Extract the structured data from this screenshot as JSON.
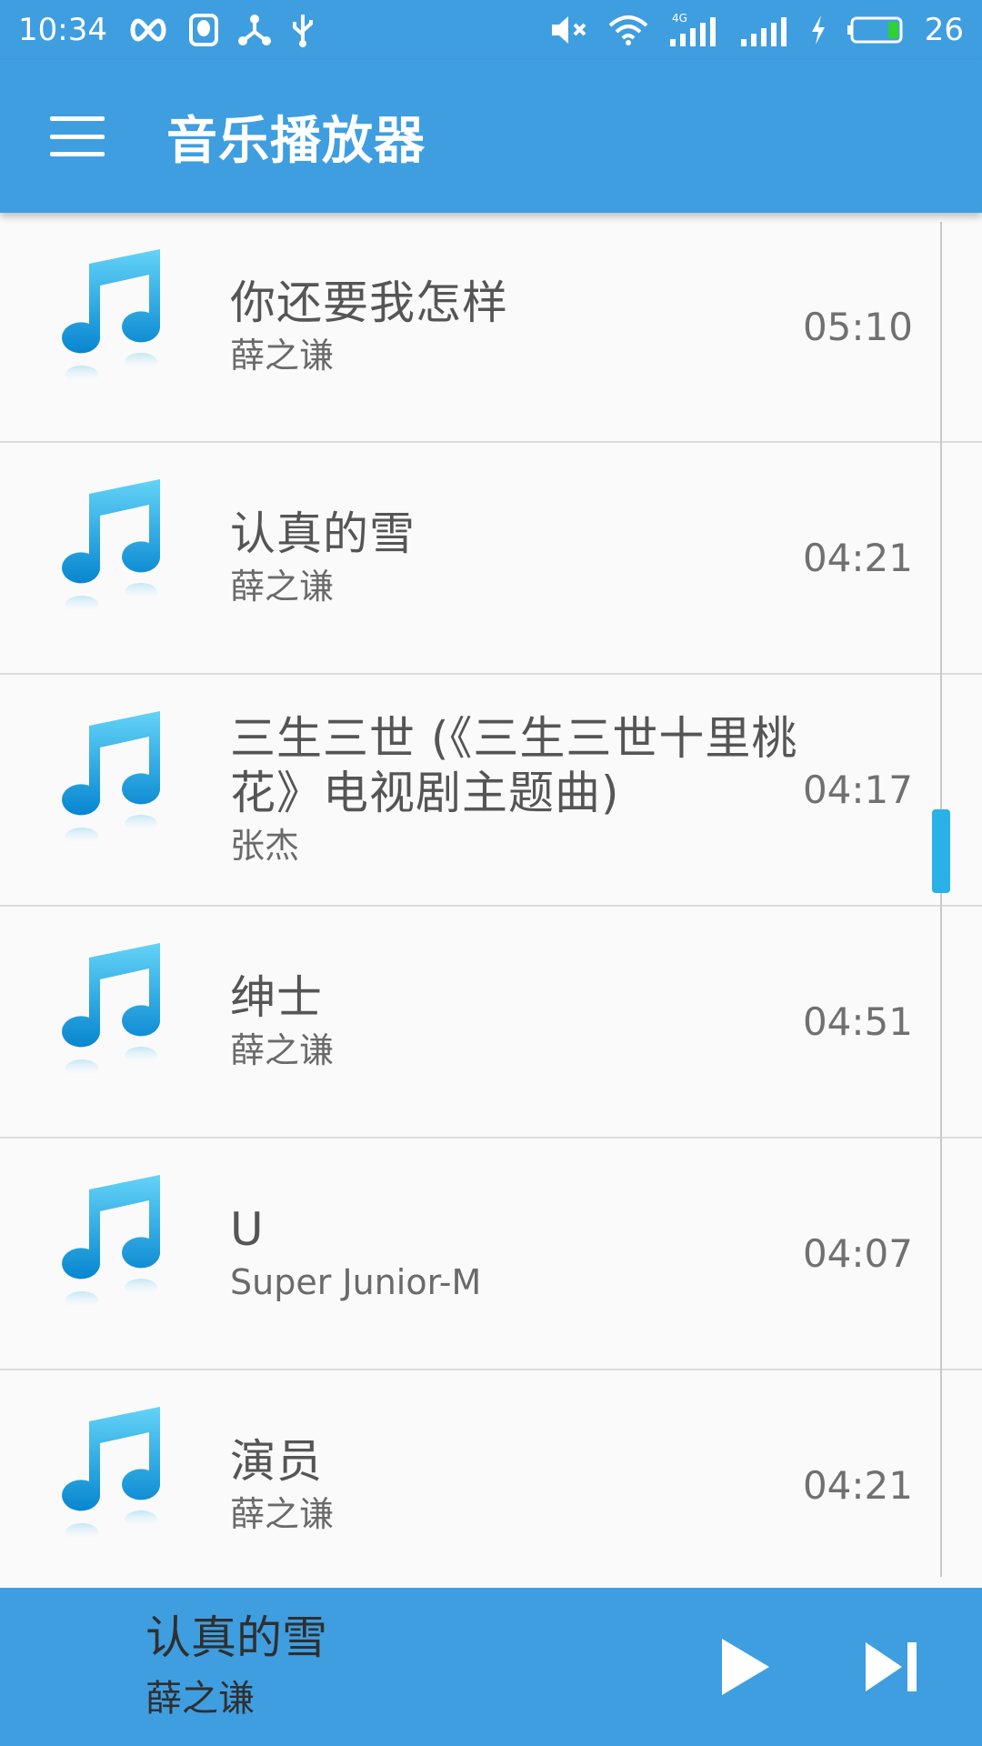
{
  "status_bar": {
    "time": "10:34",
    "network": "4G",
    "battery": "26",
    "left_icons": [
      "infinity-icon",
      "qq-icon",
      "share-icon",
      "usb-icon"
    ],
    "right_icons": [
      "mute-icon",
      "wifi-icon",
      "signal-4g-icon",
      "signal-icon",
      "charging-icon",
      "battery-icon"
    ]
  },
  "toolbar": {
    "title": "音乐播放器",
    "menu_icon": "menu-icon"
  },
  "songs": [
    {
      "title": "你还要我怎样",
      "artist": "薛之谦",
      "duration": "05:10"
    },
    {
      "title": "认真的雪",
      "artist": "薛之谦",
      "duration": "04:21"
    },
    {
      "title": "三生三世 (《三生三世十里桃花》电视剧主题曲)",
      "artist": "张杰",
      "duration": "04:17"
    },
    {
      "title": "绅士",
      "artist": "薛之谦",
      "duration": "04:51"
    },
    {
      "title": "U",
      "artist": "Super Junior-M",
      "duration": "04:07"
    },
    {
      "title": "演员",
      "artist": "薛之谦",
      "duration": "04:21"
    }
  ],
  "now_playing": {
    "title": "认真的雪",
    "artist": "薛之谦",
    "play_icon": "play-icon",
    "next_icon": "skip-next-icon"
  },
  "colors": {
    "primary": "#3f9ee0",
    "note_light": "#5ecdf5",
    "note_dark": "#0a8fd6",
    "scroll_thumb": "#29b1e8"
  }
}
